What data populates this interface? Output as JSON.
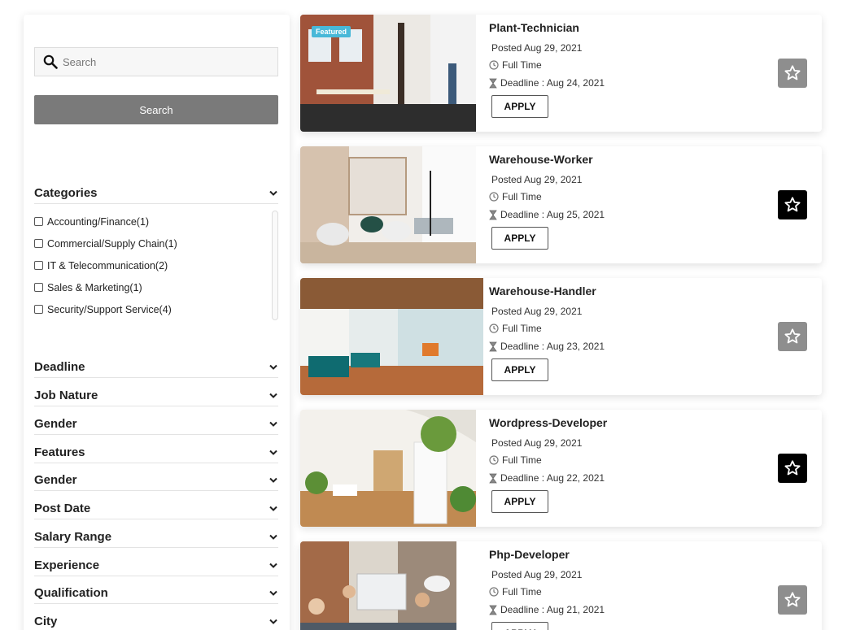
{
  "sidebar": {
    "search": {
      "placeholder": "Search",
      "value": "",
      "button_label": "Search"
    },
    "categories": {
      "title": "Categories",
      "items": [
        {
          "label": "Accounting/Finance(1)"
        },
        {
          "label": "Commercial/Supply Chain(1)"
        },
        {
          "label": "IT & Telecommunication(2)"
        },
        {
          "label": "Sales & Marketing(1)"
        },
        {
          "label": "Security/Support Service(4)"
        }
      ]
    },
    "filters": [
      {
        "label": "Deadline"
      },
      {
        "label": "Job Nature"
      },
      {
        "label": "Gender"
      },
      {
        "label": "Features"
      },
      {
        "label": "Gender"
      },
      {
        "label": "Post Date"
      },
      {
        "label": "Salary Range"
      },
      {
        "label": "Experience"
      },
      {
        "label": "Qualification"
      },
      {
        "label": "City"
      }
    ]
  },
  "jobs": [
    {
      "title": "Plant-Technician",
      "posted": "Posted Aug 29, 2021",
      "type": "Full Time",
      "deadline": "Deadline : Aug 24, 2021",
      "apply_label": "APPLY",
      "badge": "Featured",
      "favorited": false
    },
    {
      "title": "Warehouse-Worker",
      "posted": "Posted Aug 29, 2021",
      "type": "Full Time",
      "deadline": "Deadline : Aug 25, 2021",
      "apply_label": "APPLY",
      "favorited": true
    },
    {
      "title": "Warehouse-Handler",
      "posted": "Posted Aug 29, 2021",
      "type": "Full Time",
      "deadline": "Deadline : Aug 23, 2021",
      "apply_label": "APPLY",
      "favorited": false
    },
    {
      "title": "Wordpress-Developer",
      "posted": "Posted Aug 29, 2021",
      "type": "Full Time",
      "deadline": "Deadline : Aug 22, 2021",
      "apply_label": "APPLY",
      "favorited": true
    },
    {
      "title": "Php-Developer",
      "posted": "Posted Aug 29, 2021",
      "type": "Full Time",
      "deadline": "Deadline : Aug 21, 2021",
      "apply_label": "APPLY",
      "favorited": false
    }
  ],
  "icons": {
    "search": "search-icon",
    "chevron": "chevron-down-icon",
    "clock": "clock-icon",
    "hourglass": "hourglass-icon",
    "star": "star-icon"
  },
  "colors": {
    "badge": "#48b8d8",
    "search_button": "#7a7a7a",
    "star_inactive": "#8e8e8e",
    "star_active": "#000000"
  }
}
